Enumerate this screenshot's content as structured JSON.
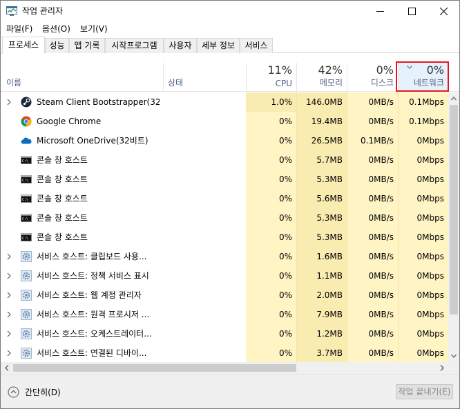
{
  "window": {
    "title": "작업 관리자"
  },
  "menu": [
    "파일(F)",
    "옵션(O)",
    "보기(V)"
  ],
  "tabs": [
    "프로세스",
    "성능",
    "앱 기록",
    "시작프로그램",
    "사용자",
    "세부 정보",
    "서비스"
  ],
  "header": {
    "name": "이름",
    "status": "상태",
    "cpu": {
      "pct": "11%",
      "label": "CPU"
    },
    "memory": {
      "pct": "42%",
      "label": "메모리"
    },
    "disk": {
      "pct": "0%",
      "label": "디스크"
    },
    "network": {
      "pct": "0%",
      "label": "네트워크"
    }
  },
  "colors": {
    "highlight": "#e8161c",
    "cell_light": "#fff4c4",
    "cell_medium": "#f9ecb0",
    "header_label": "#4d6082"
  },
  "rows": [
    {
      "name": "Steam Client Bootstrapper(32...",
      "icon": "steam-icon",
      "expandable": true,
      "cpu": "1.0%",
      "memory": "146.0MB",
      "disk": "0MB/s",
      "network": "0.1Mbps"
    },
    {
      "name": "Google Chrome",
      "icon": "chrome-icon",
      "expandable": false,
      "cpu": "0%",
      "memory": "19.4MB",
      "disk": "0MB/s",
      "network": "0.1Mbps"
    },
    {
      "name": "Microsoft OneDrive(32비트)",
      "icon": "onedrive-icon",
      "expandable": false,
      "cpu": "0%",
      "memory": "26.5MB",
      "disk": "0.1MB/s",
      "network": "0Mbps"
    },
    {
      "name": "콘솔 창 호스트",
      "icon": "console-icon",
      "expandable": false,
      "cpu": "0%",
      "memory": "5.7MB",
      "disk": "0MB/s",
      "network": "0Mbps"
    },
    {
      "name": "콘솔 창 호스트",
      "icon": "console-icon",
      "expandable": false,
      "cpu": "0%",
      "memory": "5.3MB",
      "disk": "0MB/s",
      "network": "0Mbps"
    },
    {
      "name": "콘솔 창 호스트",
      "icon": "console-icon",
      "expandable": false,
      "cpu": "0%",
      "memory": "5.6MB",
      "disk": "0MB/s",
      "network": "0Mbps"
    },
    {
      "name": "콘솔 창 호스트",
      "icon": "console-icon",
      "expandable": false,
      "cpu": "0%",
      "memory": "5.3MB",
      "disk": "0MB/s",
      "network": "0Mbps"
    },
    {
      "name": "콘솔 창 호스트",
      "icon": "console-icon",
      "expandable": false,
      "cpu": "0%",
      "memory": "5.3MB",
      "disk": "0MB/s",
      "network": "0Mbps"
    },
    {
      "name": "서비스 호스트: 클립보드 사용...",
      "icon": "gear-icon",
      "expandable": true,
      "cpu": "0%",
      "memory": "1.6MB",
      "disk": "0MB/s",
      "network": "0Mbps"
    },
    {
      "name": "서비스 호스트: 정책 서비스 표시",
      "icon": "gear-icon",
      "expandable": true,
      "cpu": "0%",
      "memory": "1.1MB",
      "disk": "0MB/s",
      "network": "0Mbps"
    },
    {
      "name": "서비스 호스트: 웹 계정 관리자",
      "icon": "gear-icon",
      "expandable": true,
      "cpu": "0%",
      "memory": "2.0MB",
      "disk": "0MB/s",
      "network": "0Mbps"
    },
    {
      "name": "서비스 호스트: 원격 프로시저 ...",
      "icon": "gear-icon",
      "expandable": true,
      "cpu": "0%",
      "memory": "7.9MB",
      "disk": "0MB/s",
      "network": "0Mbps"
    },
    {
      "name": "서비스 호스트: 오케스트레이터...",
      "icon": "gear-icon",
      "expandable": true,
      "cpu": "0%",
      "memory": "1.2MB",
      "disk": "0MB/s",
      "network": "0Mbps"
    },
    {
      "name": "서비스 호스트: 연결된 디바이...",
      "icon": "gear-icon",
      "expandable": true,
      "cpu": "0%",
      "memory": "3.7MB",
      "disk": "0MB/s",
      "network": "0Mbps"
    }
  ],
  "footer": {
    "fewer_details": "간단히(D)",
    "end_task": "작업 끝내기(E)"
  }
}
